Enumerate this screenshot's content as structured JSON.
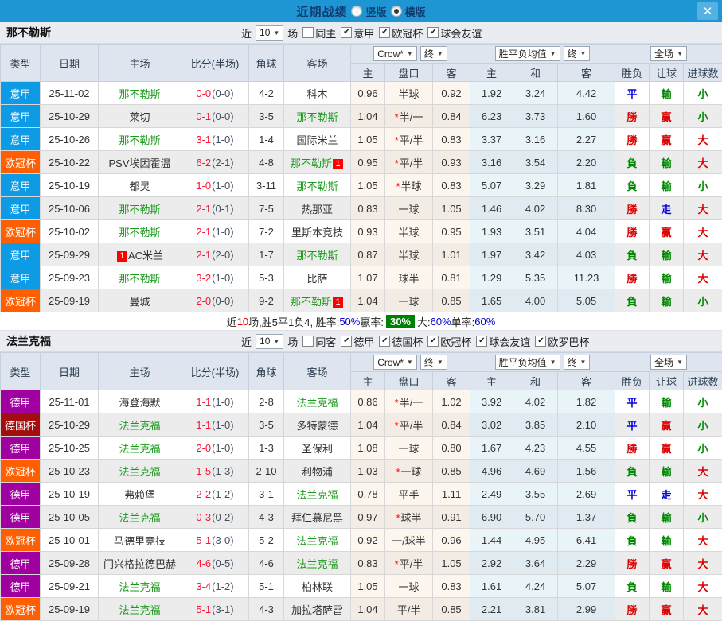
{
  "titlebar": {
    "title": "近期战绩",
    "vertical_label": "竖版",
    "horizontal_label": "横版",
    "selected_layout": "横版"
  },
  "icons": {
    "chevron_down": "▼",
    "check": "✔",
    "close": "✕",
    "star": "*"
  },
  "colors": {
    "titlebar_bg": "#1e96d3",
    "score": "#ff1133",
    "half": "#44505e",
    "focus_team": "#1a9a1a",
    "win": "#dd0000",
    "draw": "#0000dd",
    "lose": "#008800",
    "pct_blue": "#0000cc",
    "pct_green_bg": "#008000",
    "league": {
      "意甲": "#0d9be6",
      "欧冠杯": "#ff5f01",
      "德甲": "#a000a0",
      "德国杯": "#a30d0d"
    }
  },
  "sections": [
    {
      "team": "那不勒斯",
      "filter": {
        "near": "近",
        "count": "10",
        "games": "场",
        "same": "同主",
        "same_checked": false,
        "leagues": [
          "意甲",
          "欧冠杯",
          "球会友谊"
        ]
      },
      "dropdowns": {
        "odds_source": "Crow*",
        "odds_time": "终",
        "avg_label": "胜平负均值",
        "avg_time": "终",
        "scope": "全场"
      },
      "columns": [
        "类型",
        "日期",
        "主场",
        "比分(半场)",
        "角球",
        "客场"
      ],
      "subcolumns": [
        "主",
        "盘口",
        "客",
        "主",
        "和",
        "客",
        "胜负",
        "让球",
        "进球数"
      ],
      "rows": [
        {
          "league": "意甲",
          "date": "25-11-02",
          "home": "那不勒斯",
          "home_focus": true,
          "score": "0-0",
          "half": "(0-0)",
          "corners": "4-2",
          "away": "科木",
          "away_focus": false,
          "crow": [
            "0.96",
            "半球",
            "0.92"
          ],
          "star": false,
          "avg": [
            "1.92",
            "3.24",
            "4.42"
          ],
          "results": [
            [
              "平",
              "b"
            ],
            [
              "輸",
              "g"
            ],
            [
              "小",
              "g"
            ]
          ]
        },
        {
          "league": "意甲",
          "date": "25-10-29",
          "home": "莱切",
          "home_focus": false,
          "score": "0-1",
          "half": "(0-0)",
          "corners": "3-5",
          "away": "那不勒斯",
          "away_focus": true,
          "crow": [
            "1.04",
            "半/一",
            "0.84"
          ],
          "star": true,
          "avg": [
            "6.23",
            "3.73",
            "1.60"
          ],
          "results": [
            [
              "勝",
              "r"
            ],
            [
              "赢",
              "r"
            ],
            [
              "小",
              "g"
            ]
          ]
        },
        {
          "league": "意甲",
          "date": "25-10-26",
          "home": "那不勒斯",
          "home_focus": true,
          "score": "3-1",
          "half": "(1-0)",
          "corners": "1-4",
          "away": "国际米兰",
          "away_focus": false,
          "crow": [
            "1.05",
            "平/半",
            "0.83"
          ],
          "star": true,
          "avg": [
            "3.37",
            "3.16",
            "2.27"
          ],
          "results": [
            [
              "勝",
              "r"
            ],
            [
              "赢",
              "r"
            ],
            [
              "大",
              "r"
            ]
          ]
        },
        {
          "league": "欧冠杯",
          "date": "25-10-22",
          "home": "PSV埃因霍温",
          "home_focus": false,
          "score": "6-2",
          "half": "(2-1)",
          "corners": "4-8",
          "away": "那不勒斯",
          "away_focus": true,
          "away_badge": "1",
          "crow": [
            "0.95",
            "平/半",
            "0.93"
          ],
          "star": true,
          "avg": [
            "3.16",
            "3.54",
            "2.20"
          ],
          "results": [
            [
              "負",
              "g"
            ],
            [
              "輸",
              "g"
            ],
            [
              "大",
              "r"
            ]
          ]
        },
        {
          "league": "意甲",
          "date": "25-10-19",
          "home": "都灵",
          "home_focus": false,
          "score": "1-0",
          "half": "(1-0)",
          "corners": "3-11",
          "away": "那不勒斯",
          "away_focus": true,
          "crow": [
            "1.05",
            "半球",
            "0.83"
          ],
          "star": true,
          "avg": [
            "5.07",
            "3.29",
            "1.81"
          ],
          "results": [
            [
              "負",
              "g"
            ],
            [
              "輸",
              "g"
            ],
            [
              "小",
              "g"
            ]
          ]
        },
        {
          "league": "意甲",
          "date": "25-10-06",
          "home": "那不勒斯",
          "home_focus": true,
          "score": "2-1",
          "half": "(0-1)",
          "corners": "7-5",
          "away": "热那亚",
          "away_focus": false,
          "crow": [
            "0.83",
            "一球",
            "1.05"
          ],
          "star": false,
          "avg": [
            "1.46",
            "4.02",
            "8.30"
          ],
          "results": [
            [
              "勝",
              "r"
            ],
            [
              "走",
              "b"
            ],
            [
              "大",
              "r"
            ]
          ]
        },
        {
          "league": "欧冠杯",
          "date": "25-10-02",
          "home": "那不勒斯",
          "home_focus": true,
          "score": "2-1",
          "half": "(1-0)",
          "corners": "7-2",
          "away": "里斯本竞技",
          "away_focus": false,
          "crow": [
            "0.93",
            "半球",
            "0.95"
          ],
          "star": false,
          "avg": [
            "1.93",
            "3.51",
            "4.04"
          ],
          "results": [
            [
              "勝",
              "r"
            ],
            [
              "赢",
              "r"
            ],
            [
              "大",
              "r"
            ]
          ]
        },
        {
          "league": "意甲",
          "date": "25-09-29",
          "home": "AC米兰",
          "home_focus": false,
          "home_badge": "1",
          "home_badge_left": true,
          "score": "2-1",
          "half": "(2-0)",
          "corners": "1-7",
          "away": "那不勒斯",
          "away_focus": true,
          "crow": [
            "0.87",
            "半球",
            "1.01"
          ],
          "star": false,
          "avg": [
            "1.97",
            "3.42",
            "4.03"
          ],
          "results": [
            [
              "負",
              "g"
            ],
            [
              "輸",
              "g"
            ],
            [
              "大",
              "r"
            ]
          ]
        },
        {
          "league": "意甲",
          "date": "25-09-23",
          "home": "那不勒斯",
          "home_focus": true,
          "score": "3-2",
          "half": "(1-0)",
          "corners": "5-3",
          "away": "比萨",
          "away_focus": false,
          "crow": [
            "1.07",
            "球半",
            "0.81"
          ],
          "star": false,
          "avg": [
            "1.29",
            "5.35",
            "11.23"
          ],
          "results": [
            [
              "勝",
              "r"
            ],
            [
              "輸",
              "g"
            ],
            [
              "大",
              "r"
            ]
          ]
        },
        {
          "league": "欧冠杯",
          "date": "25-09-19",
          "home": "曼城",
          "home_focus": false,
          "score": "2-0",
          "half": "(0-0)",
          "corners": "9-2",
          "away": "那不勒斯",
          "away_focus": true,
          "away_badge": "1",
          "crow": [
            "1.04",
            "一球",
            "0.85"
          ],
          "star": false,
          "avg": [
            "1.65",
            "4.00",
            "5.05"
          ],
          "results": [
            [
              "負",
              "g"
            ],
            [
              "輸",
              "g"
            ],
            [
              "小",
              "g"
            ]
          ]
        }
      ],
      "summary": [
        {
          "t": "近"
        },
        {
          "t": "10",
          "c": "red"
        },
        {
          "t": "场,胜5平1负4, 胜率:"
        },
        {
          "t": "50%",
          "c": "blue"
        },
        {
          "t": " 赢率: "
        },
        {
          "t": "30%",
          "c": "greenbox"
        },
        {
          "t": " 大:"
        },
        {
          "t": "60%",
          "c": "blue"
        },
        {
          "t": " 单率:"
        },
        {
          "t": "60%",
          "c": "blue"
        }
      ]
    },
    {
      "team": "法兰克福",
      "filter": {
        "near": "近",
        "count": "10",
        "games": "场",
        "same": "同客",
        "same_checked": false,
        "leagues": [
          "德甲",
          "德国杯",
          "欧冠杯",
          "球会友谊",
          "欧罗巴杯"
        ]
      },
      "dropdowns": {
        "odds_source": "Crow*",
        "odds_time": "终",
        "avg_label": "胜平负均值",
        "avg_time": "终",
        "scope": "全场"
      },
      "columns": [
        "类型",
        "日期",
        "主场",
        "比分(半场)",
        "角球",
        "客场"
      ],
      "subcolumns": [
        "主",
        "盘口",
        "客",
        "主",
        "和",
        "客",
        "胜负",
        "让球",
        "进球数"
      ],
      "rows": [
        {
          "league": "德甲",
          "date": "25-11-01",
          "home": "海登海默",
          "home_focus": false,
          "score": "1-1",
          "half": "(1-0)",
          "corners": "2-8",
          "away": "法兰克福",
          "away_focus": true,
          "crow": [
            "0.86",
            "半/一",
            "1.02"
          ],
          "star": true,
          "avg": [
            "3.92",
            "4.02",
            "1.82"
          ],
          "results": [
            [
              "平",
              "b"
            ],
            [
              "輸",
              "g"
            ],
            [
              "小",
              "g"
            ]
          ]
        },
        {
          "league": "德国杯",
          "date": "25-10-29",
          "home": "法兰克福",
          "home_focus": true,
          "score": "1-1",
          "half": "(1-0)",
          "corners": "3-5",
          "away": "多特蒙德",
          "away_focus": false,
          "crow": [
            "1.04",
            "平/半",
            "0.84"
          ],
          "star": true,
          "avg": [
            "3.02",
            "3.85",
            "2.10"
          ],
          "results": [
            [
              "平",
              "b"
            ],
            [
              "赢",
              "r"
            ],
            [
              "小",
              "g"
            ]
          ]
        },
        {
          "league": "德甲",
          "date": "25-10-25",
          "home": "法兰克福",
          "home_focus": true,
          "score": "2-0",
          "half": "(1-0)",
          "corners": "1-3",
          "away": "圣保利",
          "away_focus": false,
          "crow": [
            "1.08",
            "一球",
            "0.80"
          ],
          "star": false,
          "avg": [
            "1.67",
            "4.23",
            "4.55"
          ],
          "results": [
            [
              "勝",
              "r"
            ],
            [
              "赢",
              "r"
            ],
            [
              "小",
              "g"
            ]
          ]
        },
        {
          "league": "欧冠杯",
          "date": "25-10-23",
          "home": "法兰克福",
          "home_focus": true,
          "score": "1-5",
          "half": "(1-3)",
          "corners": "2-10",
          "away": "利物浦",
          "away_focus": false,
          "crow": [
            "1.03",
            "一球",
            "0.85"
          ],
          "star": true,
          "avg": [
            "4.96",
            "4.69",
            "1.56"
          ],
          "results": [
            [
              "負",
              "g"
            ],
            [
              "輸",
              "g"
            ],
            [
              "大",
              "r"
            ]
          ]
        },
        {
          "league": "德甲",
          "date": "25-10-19",
          "home": "弗赖堡",
          "home_focus": false,
          "score": "2-2",
          "half": "(1-2)",
          "corners": "3-1",
          "away": "法兰克福",
          "away_focus": true,
          "crow": [
            "0.78",
            "平手",
            "1.11"
          ],
          "star": false,
          "avg": [
            "2.49",
            "3.55",
            "2.69"
          ],
          "results": [
            [
              "平",
              "b"
            ],
            [
              "走",
              "b"
            ],
            [
              "大",
              "r"
            ]
          ]
        },
        {
          "league": "德甲",
          "date": "25-10-05",
          "home": "法兰克福",
          "home_focus": true,
          "score": "0-3",
          "half": "(0-2)",
          "corners": "4-3",
          "away": "拜仁慕尼黑",
          "away_focus": false,
          "crow": [
            "0.97",
            "球半",
            "0.91"
          ],
          "star": true,
          "avg": [
            "6.90",
            "5.70",
            "1.37"
          ],
          "results": [
            [
              "負",
              "g"
            ],
            [
              "輸",
              "g"
            ],
            [
              "小",
              "g"
            ]
          ]
        },
        {
          "league": "欧冠杯",
          "date": "25-10-01",
          "home": "马德里竞技",
          "home_focus": false,
          "score": "5-1",
          "half": "(3-0)",
          "corners": "5-2",
          "away": "法兰克福",
          "away_focus": true,
          "crow": [
            "0.92",
            "一/球半",
            "0.96"
          ],
          "star": false,
          "avg": [
            "1.44",
            "4.95",
            "6.41"
          ],
          "results": [
            [
              "負",
              "g"
            ],
            [
              "輸",
              "g"
            ],
            [
              "大",
              "r"
            ]
          ]
        },
        {
          "league": "德甲",
          "date": "25-09-28",
          "home": "门兴格拉德巴赫",
          "home_focus": false,
          "score": "4-6",
          "half": "(0-5)",
          "corners": "4-6",
          "away": "法兰克福",
          "away_focus": true,
          "crow": [
            "0.83",
            "平/半",
            "1.05"
          ],
          "star": true,
          "avg": [
            "2.92",
            "3.64",
            "2.29"
          ],
          "results": [
            [
              "勝",
              "r"
            ],
            [
              "赢",
              "r"
            ],
            [
              "大",
              "r"
            ]
          ]
        },
        {
          "league": "德甲",
          "date": "25-09-21",
          "home": "法兰克福",
          "home_focus": true,
          "score": "3-4",
          "half": "(1-2)",
          "corners": "5-1",
          "away": "柏林联",
          "away_focus": false,
          "crow": [
            "1.05",
            "一球",
            "0.83"
          ],
          "star": false,
          "avg": [
            "1.61",
            "4.24",
            "5.07"
          ],
          "results": [
            [
              "負",
              "g"
            ],
            [
              "輸",
              "g"
            ],
            [
              "大",
              "r"
            ]
          ]
        },
        {
          "league": "欧冠杯",
          "date": "25-09-19",
          "home": "法兰克福",
          "home_focus": true,
          "score": "5-1",
          "half": "(3-1)",
          "corners": "4-3",
          "away": "加拉塔萨雷",
          "away_focus": false,
          "crow": [
            "1.04",
            "平/半",
            "0.85"
          ],
          "star": false,
          "avg": [
            "2.21",
            "3.81",
            "2.99"
          ],
          "results": [
            [
              "勝",
              "r"
            ],
            [
              "赢",
              "r"
            ],
            [
              "大",
              "r"
            ]
          ]
        }
      ]
    }
  ]
}
